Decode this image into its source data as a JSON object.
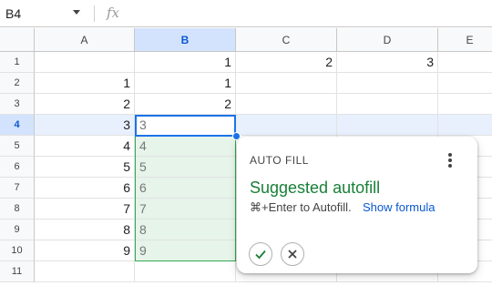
{
  "formula_bar": {
    "name_box": "B4",
    "fx": "fx"
  },
  "columns": [
    "A",
    "B",
    "C",
    "D",
    "E"
  ],
  "rows": [
    "1",
    "2",
    "3",
    "4",
    "5",
    "6",
    "7",
    "8",
    "9",
    "10",
    "11"
  ],
  "cells": {
    "B1": "1",
    "C1": "2",
    "D1": "3",
    "A2": "1",
    "B2": "1",
    "A3": "2",
    "B3": "2",
    "A4": "3",
    "A5": "4",
    "A6": "5",
    "A7": "6",
    "A8": "7",
    "A9": "8",
    "A10": "9"
  },
  "suggested_values": [
    "3",
    "4",
    "5",
    "6",
    "7",
    "8",
    "9"
  ],
  "autofill_popup": {
    "title": "AUTO FILL",
    "heading": "Suggested autofill",
    "description": "⌘+Enter to Autofill.",
    "link": "Show formula"
  },
  "colors": {
    "accent": "#1a73e8",
    "success": "#188038",
    "suggest_fill": "#e6f4ea"
  },
  "icons": {
    "accept": "check-icon",
    "reject": "close-icon",
    "more": "more-vert-icon",
    "function": "fx-icon",
    "dropdown": "caret-down-icon"
  }
}
